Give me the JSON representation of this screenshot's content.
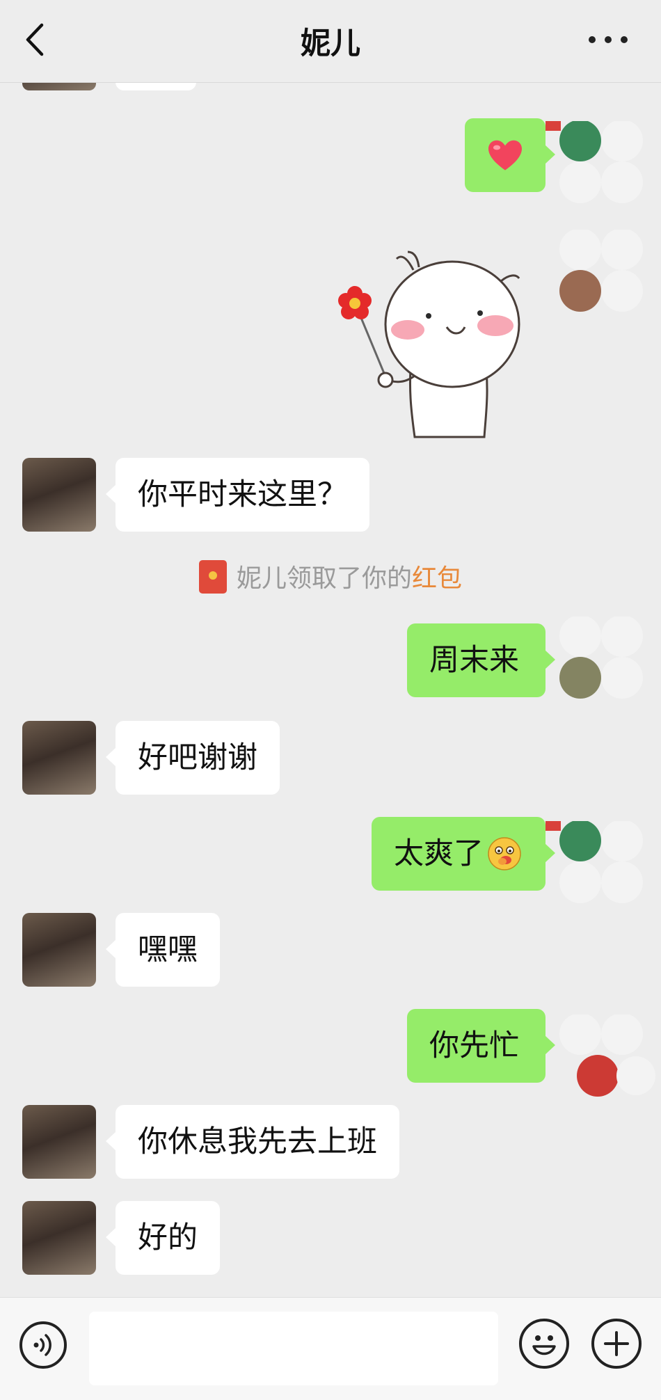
{
  "header": {
    "title": "妮儿",
    "back_icon": "chevron-left-icon",
    "more_icon": "more-dots-icon"
  },
  "messages": [
    {
      "side": "in",
      "text": ""
    },
    {
      "side": "out",
      "text": "",
      "content": "heart-emoji"
    },
    {
      "side": "out",
      "text": "",
      "content": "cartoon-flower-sticker"
    },
    {
      "side": "in",
      "text": "你平时来这里？"
    },
    {
      "side": "system",
      "text": "妮儿领取了你的",
      "link": "红包"
    },
    {
      "side": "out",
      "text": "周末来"
    },
    {
      "side": "in",
      "text": "好吧谢谢"
    },
    {
      "side": "out",
      "text": "太爽了",
      "emoji": "cheeky-face-emoji"
    },
    {
      "side": "in",
      "text": "嘿嘿"
    },
    {
      "side": "out",
      "text": "你先忙"
    },
    {
      "side": "in",
      "text": "你休息我先去上班"
    },
    {
      "side": "in",
      "text": "好的"
    }
  ],
  "input_bar": {
    "voice_icon": "voice-icon",
    "text_value": "",
    "emoji_icon": "emoji-icon",
    "plus_icon": "plus-icon"
  },
  "colors": {
    "background": "#ededed",
    "bubble_out": "#95ec69",
    "bubble_in": "#ffffff",
    "red_packet_link": "#e8893a"
  }
}
